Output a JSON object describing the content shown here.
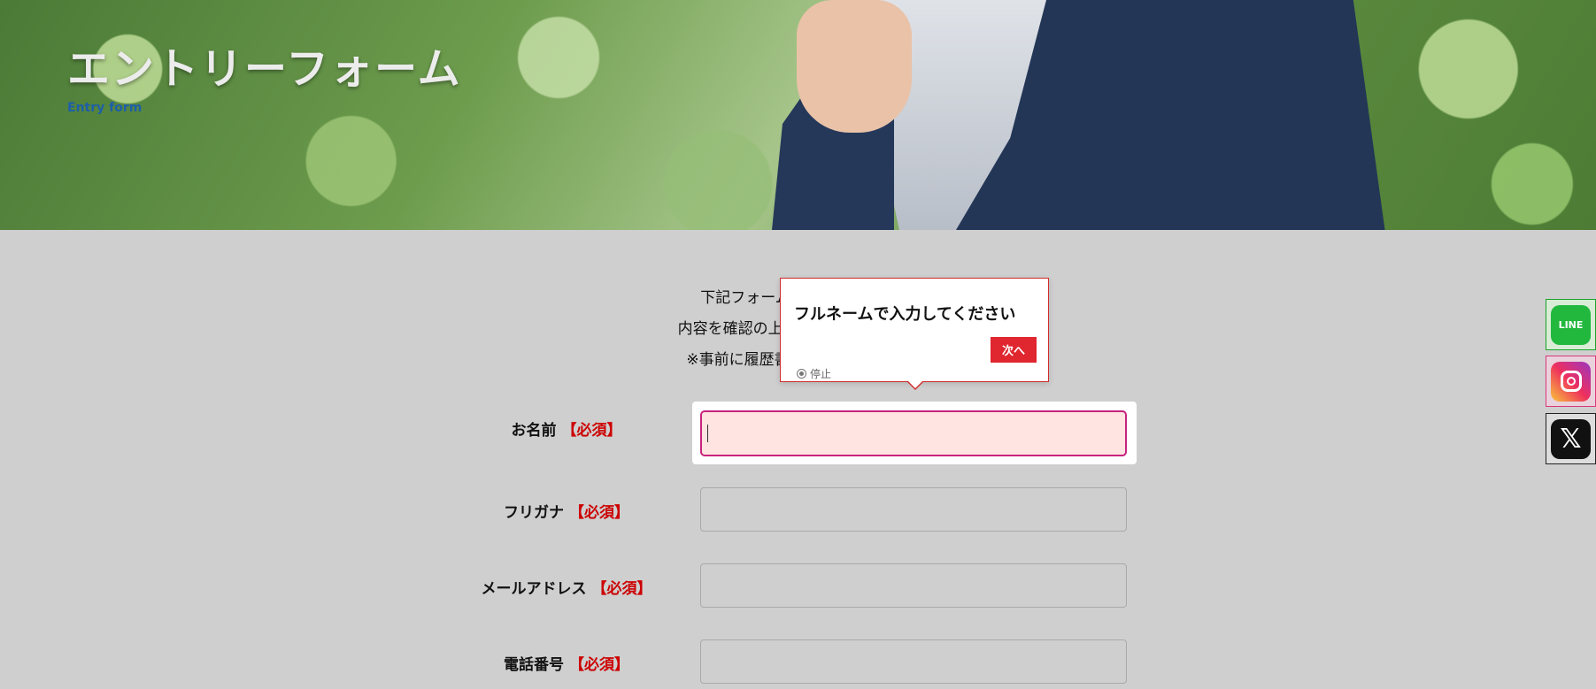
{
  "hero": {
    "title": "エントリーフォーム",
    "subtitle": "Entry form"
  },
  "intro": {
    "line1": "下記フォームをご入力の上、",
    "line2": "内容を確認の上、担当者よりメール",
    "line3": "※事前に履歴書・職務経歴書のご"
  },
  "form": {
    "fields": [
      {
        "label": "お名前",
        "required": "【必須】",
        "value": ""
      },
      {
        "label": "フリガナ",
        "required": "【必須】",
        "value": ""
      },
      {
        "label": "メールアドレス",
        "required": "【必須】",
        "value": ""
      },
      {
        "label": "電話番号",
        "required": "【必須】",
        "value": ""
      }
    ]
  },
  "popover": {
    "message": "フルネームで入力してください",
    "next_label": "次へ",
    "stop_label": "停止"
  },
  "social": {
    "line_label": "LINE",
    "x_label": "𝕏"
  },
  "colors": {
    "background": "#cfcfcf",
    "required": "#cc0000",
    "accent_button": "#e0262e",
    "active_border": "#c7237f",
    "active_fill": "#ffe4e1",
    "subtitle": "#1d5fa8"
  }
}
